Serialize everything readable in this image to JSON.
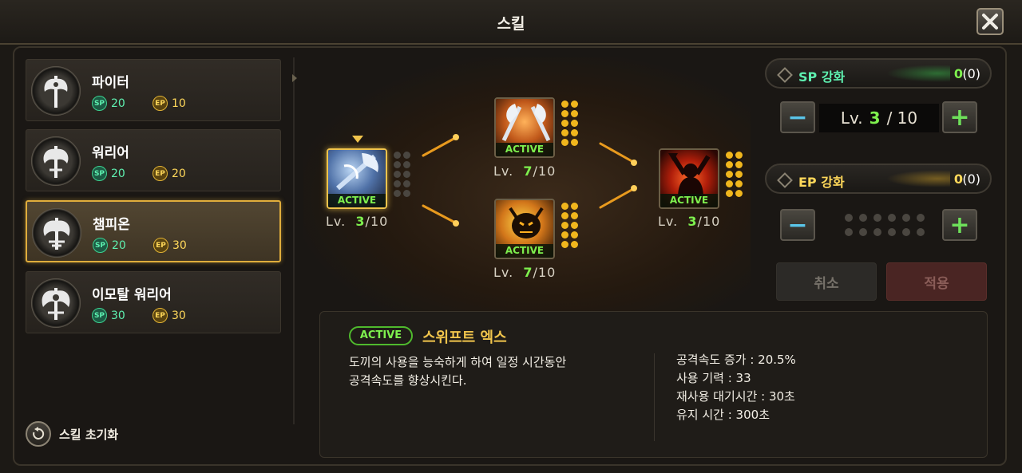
{
  "window": {
    "title": "스킬"
  },
  "jobs": [
    {
      "name": "파이터",
      "sp_label": "SP",
      "sp": "20",
      "ep_label": "EP",
      "ep": "10",
      "selected": false
    },
    {
      "name": "워리어",
      "sp_label": "SP",
      "sp": "20",
      "ep_label": "EP",
      "ep": "20",
      "selected": false
    },
    {
      "name": "챔피온",
      "sp_label": "SP",
      "sp": "20",
      "ep_label": "EP",
      "ep": "30",
      "selected": true
    },
    {
      "name": "이모탈 워리어",
      "sp_label": "SP",
      "sp": "30",
      "ep_label": "EP",
      "ep": "30",
      "selected": false
    }
  ],
  "reset_label": "스킬 초기화",
  "skills": [
    {
      "tag": "ACTIVE",
      "lv_prefix": "Lv.",
      "level": "3",
      "max": "/10",
      "selected": true
    },
    {
      "tag": "ACTIVE",
      "lv_prefix": "Lv.",
      "level": "7",
      "max": "/10",
      "selected": false
    },
    {
      "tag": "ACTIVE",
      "lv_prefix": "Lv.",
      "level": "7",
      "max": "/10",
      "selected": false
    },
    {
      "tag": "ACTIVE",
      "lv_prefix": "Lv.",
      "level": "3",
      "max": "/10",
      "selected": false
    }
  ],
  "sp_panel": {
    "label": "SP 강화",
    "value": "0",
    "paren": "(0)",
    "lv_prefix": "Lv.",
    "level": "3",
    "max": "/ 10"
  },
  "ep_panel": {
    "label": "EP 강화",
    "value": "0",
    "paren": "(0)"
  },
  "buttons": {
    "minus": "−",
    "plus": "+",
    "cancel": "취소",
    "apply": "적용"
  },
  "info": {
    "tag": "ACTIVE",
    "title": "스위프트 엑스",
    "desc_line1": "도끼의 사용을 능숙하게 하여 일정 시간동안",
    "desc_line2": "공격속도를 향상시킨다.",
    "stats": [
      "공격속도 증가 : 20.5%",
      "사용 기력 : 33",
      "재사용 대기시간 : 30초",
      "유지 시간 : 300초"
    ]
  },
  "colors": {
    "accent": "#f0c44c",
    "active_green": "#7ef04e",
    "sp_green": "#5ef0b0",
    "ep_gold": "#ffd85a"
  }
}
